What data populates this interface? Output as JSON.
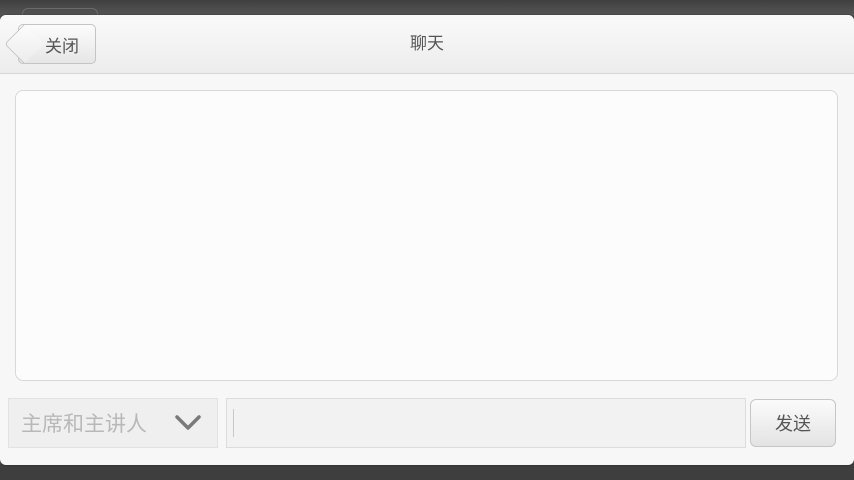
{
  "header": {
    "back_label": "关闭",
    "title": "聊天"
  },
  "composer": {
    "recipient_value": "主席和主讲人",
    "message_value": "",
    "send_label": "发送"
  },
  "icons": {
    "back": "chevron-left-icon",
    "dropdown": "chevron-down-icon"
  }
}
